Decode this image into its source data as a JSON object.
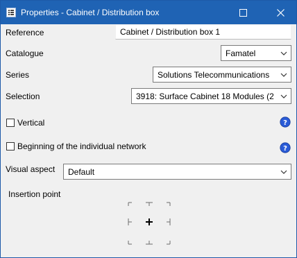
{
  "window": {
    "title": "Properties - Cabinet / Distribution box"
  },
  "fields": {
    "reference": {
      "label": "Reference",
      "value": "Cabinet / Distribution box 1"
    },
    "catalogue": {
      "label": "Catalogue",
      "value": "Famatel"
    },
    "series": {
      "label": "Series",
      "value": "Solutions Telecommunications"
    },
    "selection": {
      "label": "Selection",
      "value": "3918: Surface Cabinet 18 Modules (2..."
    },
    "vertical": {
      "label": "Vertical",
      "checked": false
    },
    "beginning": {
      "label": "Beginning of the individual network",
      "checked": false
    },
    "visual_aspect": {
      "label": "Visual aspect",
      "value": "Default"
    }
  },
  "insertion": {
    "label": "Insertion point"
  },
  "icons": {
    "app": "app-properties-icon",
    "maximize": "maximize-icon",
    "close": "close-icon",
    "help": "help-icon",
    "dropdown": "chevron-down-icon",
    "crosshair": "crosshair-icon"
  },
  "colors": {
    "titlebar": "#1f63b4",
    "help": "#2a5bd7"
  }
}
